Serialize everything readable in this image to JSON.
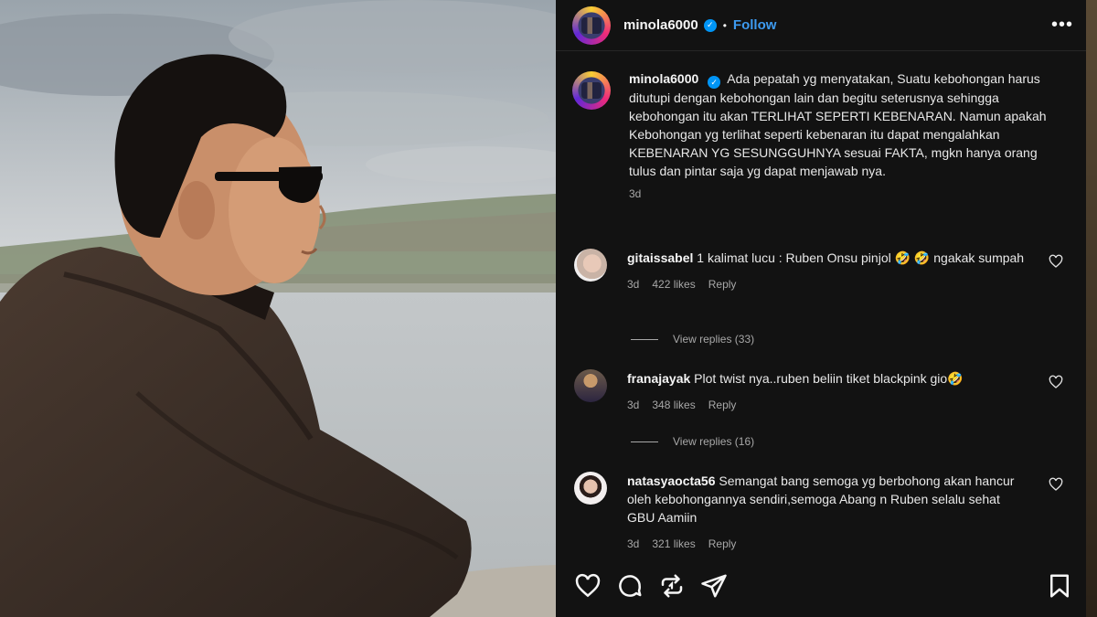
{
  "post": {
    "username": "minola6000",
    "verified_mark": "✓",
    "separator": "•",
    "follow_label": "Follow",
    "more_label": "•••"
  },
  "caption": {
    "username": "minola6000",
    "text": "Ada pepatah yg menyatakan, Suatu kebohongan harus ditutupi dengan kebohongan lain dan begitu seterusnya sehingga kebohongan itu akan TERLIHAT SEPERTI KEBENARAN. Namun apakah Kebohongan yg terlihat seperti kebenaran itu dapat mengalahkan KEBENARAN YG SESUNGGUHNYA sesuai FAKTA, mgkn hanya orang tulus dan pintar saja yg dapat menjawab nya.",
    "time": "3d"
  },
  "comments": [
    {
      "username": "gitaissabel",
      "text": "1 kalimat lucu : Ruben Onsu pinjol 🤣 🤣  ngakak sumpah",
      "time": "3d",
      "likes": "422 likes",
      "reply_label": "Reply",
      "view_replies": "View replies (33)"
    },
    {
      "username": "franajayak",
      "text": "Plot twist nya..ruben beliin tiket blackpink gio🤣",
      "time": "3d",
      "likes": "348 likes",
      "reply_label": "Reply",
      "view_replies": "View replies (16)"
    },
    {
      "username": "natasyaocta56",
      "text": "Semangat bang semoga yg berbohong akan hancur oleh kebohongannya sendiri,semoga Abang n Ruben selalu sehat GBU Aamiin",
      "time": "3d",
      "likes": "321 likes",
      "reply_label": "Reply"
    }
  ],
  "icons": {
    "header_avatar": "avatar",
    "like": "heart-icon",
    "comment": "comment-icon",
    "share": "repost-icon",
    "send": "send-icon",
    "save": "bookmark-icon"
  },
  "colors": {
    "panel_bg": "#121212",
    "link_blue": "#3d9af0",
    "verified_blue": "#0095f6",
    "muted_text": "#a8a8a8"
  }
}
